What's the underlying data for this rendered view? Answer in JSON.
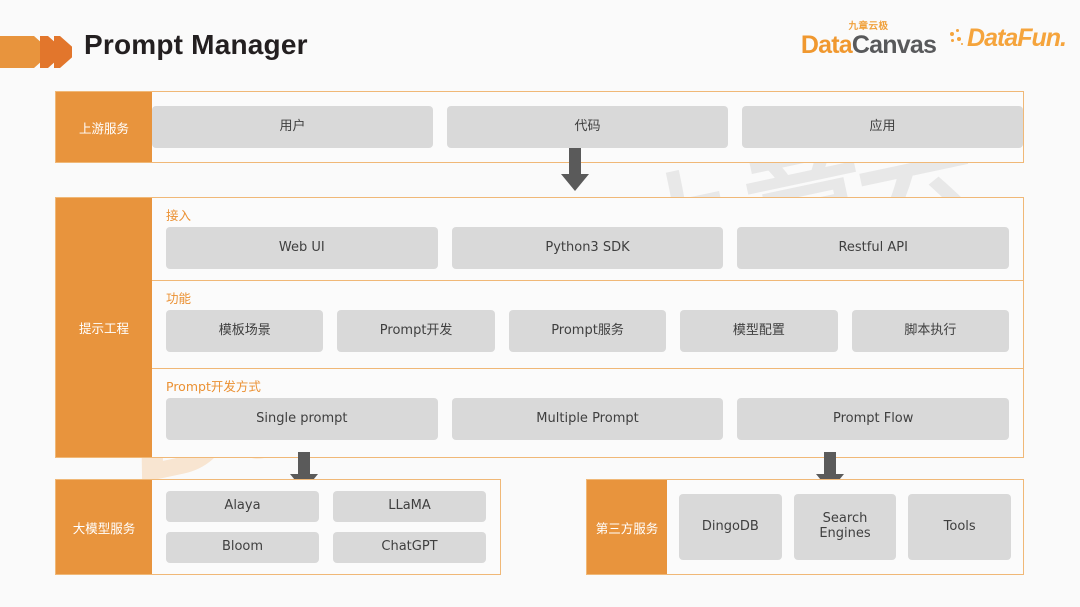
{
  "header": {
    "title": "Prompt Manager",
    "logo_datacanvas_cn": "九章云极",
    "logo_datacanvas_a": "Data",
    "logo_datacanvas_b": "Canvas",
    "logo_datafun": "DataFun."
  },
  "watermarks": {
    "cn": "九章云极",
    "en_a": "Data",
    "en_b": "Canvas"
  },
  "upstream": {
    "label": "上游服务",
    "items": [
      "用户",
      "代码",
      "应用"
    ]
  },
  "prompt_engineering": {
    "label": "提示工程",
    "sections": [
      {
        "title": "接入",
        "items": [
          "Web UI",
          "Python3 SDK",
          "Restful API"
        ]
      },
      {
        "title": "功能",
        "items": [
          "模板场景",
          "Prompt开发",
          "Prompt服务",
          "模型配置",
          "脚本执行"
        ]
      },
      {
        "title": "Prompt开发方式",
        "items": [
          "Single prompt",
          "Multiple Prompt",
          "Prompt Flow"
        ]
      }
    ]
  },
  "large_model_service": {
    "label": "大模型服务",
    "rows": [
      [
        "Alaya",
        "LLaMA"
      ],
      [
        "Bloom",
        "ChatGPT"
      ]
    ]
  },
  "third_party_service": {
    "label": "第三方服务",
    "items": [
      "DingoDB",
      "Search\nEngines",
      "Tools"
    ]
  },
  "colors": {
    "accent_orange": "#e8943d",
    "border_orange": "#f0b877",
    "sub_title_orange": "#eb9133",
    "chip_gray": "#d9d9d9",
    "arrow_gray": "#5a5a5a",
    "page_bg": "#fafafa"
  },
  "icons": {
    "header_arrow": "chevron-arrow-icon",
    "flow_arrow": "down-arrow-icon"
  }
}
